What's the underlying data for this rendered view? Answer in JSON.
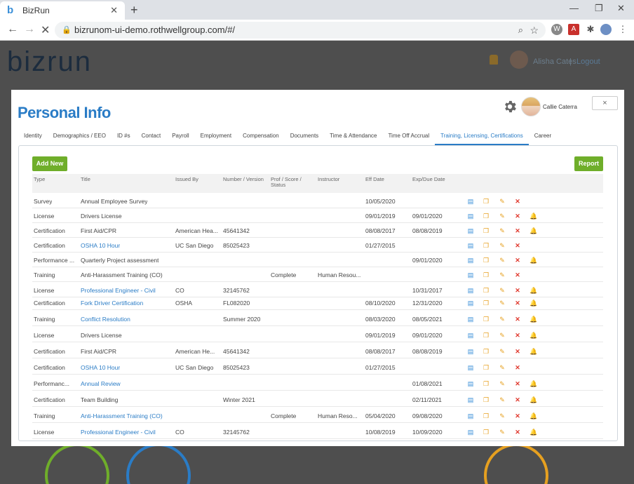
{
  "browser": {
    "tab_title": "BizRun",
    "tab_close": "✕",
    "new_tab": "+",
    "url": "bizrunom-ui-demo.rothwellgroup.com/#/"
  },
  "background": {
    "logo": "bizrun",
    "user": "Alisha Cates",
    "separator": "|",
    "logout": "Logout"
  },
  "modal": {
    "title": "Personal Info",
    "user_name": "Callie Caterra",
    "close_label": "×",
    "tabs": [
      "Identity",
      "Demographics / EEO",
      "ID #s",
      "Contact",
      "Payroll",
      "Employment",
      "Compensation",
      "Documents",
      "Time & Attendance",
      "Time Off Accrual",
      "Training, Licensing, Certifications",
      "Career"
    ],
    "active_tab": "Training, Licensing, Certifications",
    "add_new_label": "Add New",
    "report_label": "Report",
    "columns": {
      "type": "Type",
      "title": "Title",
      "issued_by": "Issued By",
      "number": "Number / Version",
      "prof": "Prof / Score /",
      "prof2": "Status",
      "instructor": "Instructor",
      "eff_date": "Eff Date",
      "exp_date": "Exp/Due Date"
    },
    "rows": [
      {
        "type": "Survey",
        "title": "Annual Employee Survey",
        "link": false,
        "issued_by": "",
        "number": "",
        "prof": "",
        "instructor": "",
        "eff": "10/05/2020",
        "exp": "",
        "bell": false
      },
      {
        "type": "License",
        "title": "Drivers License",
        "link": false,
        "issued_by": "",
        "number": "",
        "prof": "",
        "instructor": "",
        "eff": "09/01/2019",
        "exp": "09/01/2020",
        "bell": true
      },
      {
        "type": "Certification",
        "title": "First Aid/CPR",
        "link": false,
        "issued_by": "American Hea...",
        "number": "45641342",
        "prof": "",
        "instructor": "",
        "eff": "08/08/2017",
        "exp": "08/08/2019",
        "bell": true
      },
      {
        "type": "Certification",
        "title": "OSHA 10 Hour",
        "link": true,
        "issued_by": "UC San Diego",
        "number": "85025423",
        "prof": "",
        "instructor": "",
        "eff": "01/27/2015",
        "exp": "",
        "bell": false
      },
      {
        "type": "Performance ...",
        "title": "Quarterly Project assessment",
        "link": false,
        "issued_by": "",
        "number": "",
        "prof": "",
        "instructor": "",
        "eff": "",
        "exp": "09/01/2020",
        "bell": true
      },
      {
        "type": "Training",
        "title": "Anti-Harassment Training (CO)",
        "link": false,
        "issued_by": "",
        "number": "",
        "prof": "Complete",
        "instructor": "Human Resou...",
        "eff": "",
        "exp": "",
        "bell": false
      },
      {
        "type": "License",
        "title": "Professional Engineer - Civil",
        "link": true,
        "issued_by": "CO",
        "number": "32145762",
        "prof": "",
        "instructor": "",
        "eff": "",
        "exp": "10/31/2017",
        "bell": true
      },
      {
        "type": "Certification",
        "title": "Fork Driver Certification",
        "link": true,
        "issued_by": "OSHA",
        "number": "FL082020",
        "prof": "",
        "instructor": "",
        "eff": "08/10/2020",
        "exp": "12/31/2020",
        "bell": true
      },
      {
        "type": "Training",
        "title": "Conflict Resolution",
        "link": true,
        "issued_by": "",
        "number": "Summer 2020",
        "prof": "",
        "instructor": "",
        "eff": "08/03/2020",
        "exp": "08/05/2021",
        "bell": true
      },
      {
        "type": "License",
        "title": "Drivers License",
        "link": false,
        "issued_by": "",
        "number": "",
        "prof": "",
        "instructor": "",
        "eff": "09/01/2019",
        "exp": "09/01/2020",
        "bell": true
      },
      {
        "type": "Certification",
        "title": "First Aid/CPR",
        "link": false,
        "issued_by": "American He...",
        "number": "45641342",
        "prof": "",
        "instructor": "",
        "eff": "08/08/2017",
        "exp": "08/08/2019",
        "bell": true
      },
      {
        "type": "Certification",
        "title": "OSHA 10 Hour",
        "link": true,
        "issued_by": "UC San Diego",
        "number": "85025423",
        "prof": "",
        "instructor": "",
        "eff": "01/27/2015",
        "exp": "",
        "bell": false
      },
      {
        "type": "Performanc...",
        "title": "Annual Review",
        "link": true,
        "issued_by": "",
        "number": "",
        "prof": "",
        "instructor": "",
        "eff": "",
        "exp": "01/08/2021",
        "bell": true
      },
      {
        "type": "Certification",
        "title": "Team Building",
        "link": false,
        "issued_by": "",
        "number": "Winter 2021",
        "prof": "",
        "instructor": "",
        "eff": "",
        "exp": "02/11/2021",
        "bell": true
      },
      {
        "type": "Training",
        "title": "Anti-Harassment Training (CO)",
        "link": true,
        "issued_by": "",
        "number": "",
        "prof": "Complete",
        "instructor": "Human Reso...",
        "eff": "05/04/2020",
        "exp": "09/08/2020",
        "bell": true
      },
      {
        "type": "License",
        "title": "Professional Engineer - Civil",
        "link": true,
        "issued_by": "CO",
        "number": "32145762",
        "prof": "",
        "instructor": "",
        "eff": "10/08/2019",
        "exp": "10/09/2020",
        "bell": true
      }
    ]
  },
  "colors": {
    "accent": "#2a7cc6",
    "button_green": "#6fae2a",
    "delete_red": "#e03a2f",
    "copy_orange": "#e6a020",
    "bell_green": "#6fbf2a"
  },
  "icons": {
    "doc": "document-icon",
    "copy": "copy-icon",
    "edit": "pencil-icon",
    "delete": "delete-icon",
    "bell": "bell-icon"
  }
}
